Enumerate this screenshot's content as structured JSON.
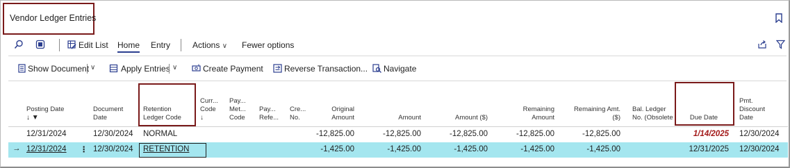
{
  "page": {
    "title": "Vendor Ledger Entries"
  },
  "actionbar": {
    "edit_list": "Edit List",
    "tabs": [
      "Home",
      "Entry"
    ],
    "actions": "Actions",
    "fewer_options": "Fewer options"
  },
  "commands": {
    "show_document": "Show Document",
    "apply_entries": "Apply Entries",
    "create_payment": "Create Payment",
    "reverse_transaction": "Reverse Transaction...",
    "navigate": "Navigate"
  },
  "columns": {
    "posting_date": "Posting Date",
    "document_date": [
      "Document",
      "Date"
    ],
    "retention_ledger_code": [
      "Retention",
      "Ledger Code"
    ],
    "currency_code": [
      "Curr...",
      "Code"
    ],
    "payment_method_code": [
      "Pay...",
      "Met...",
      "Code"
    ],
    "payment_reference": [
      "Pay...",
      "Refe..."
    ],
    "creditor_no": [
      "Cre...",
      "No."
    ],
    "original_amount": [
      "Original",
      "Amount"
    ],
    "amount": "Amount",
    "amount_lcy": "Amount ($)",
    "remaining_amount": [
      "Remaining",
      "Amount"
    ],
    "remaining_amt_lcy": [
      "Remaining Amt.",
      "($)"
    ],
    "bal_ledger_no": [
      "Bal. Ledger",
      "No. (Obsolete"
    ],
    "due_date": "Due Date",
    "pmt_discount_date": [
      "Pmt.",
      "Discount",
      "Date"
    ]
  },
  "rows": [
    {
      "posting_date": "12/31/2024",
      "document_date": "12/30/2024",
      "retention_ledger_code": "NORMAL",
      "original_amount": "-12,825.00",
      "amount": "-12,825.00",
      "amount_lcy": "-12,825.00",
      "remaining_amount": "-12,825.00",
      "remaining_amt_lcy": "-12,825.00",
      "due_date": "1/14/2025",
      "pmt_discount_date": "12/30/2024"
    },
    {
      "posting_date": "12/31/2024",
      "document_date": "12/30/2024",
      "retention_ledger_code": "RETENTION",
      "original_amount": "-1,425.00",
      "amount": "-1,425.00",
      "amount_lcy": "-1,425.00",
      "remaining_amount": "-1,425.00",
      "remaining_amt_lcy": "-1,425.00",
      "due_date": "12/31/2025",
      "pmt_discount_date": "12/30/2024"
    }
  ],
  "colors": {
    "selected_row": "#a4e6ef",
    "highlight_box": "#7a1a1a",
    "overdue": "#a31a1a",
    "accent": "#2b3e8f"
  }
}
